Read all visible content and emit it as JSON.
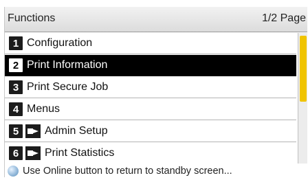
{
  "header": {
    "title": "Functions",
    "page_indicator": "1/2 Page"
  },
  "menu": {
    "items": [
      {
        "number": "1",
        "label": "Configuration",
        "icon": "",
        "selected": false
      },
      {
        "number": "2",
        "label": "Print Information",
        "icon": "",
        "selected": true
      },
      {
        "number": "3",
        "label": "Print Secure Job",
        "icon": "",
        "selected": false
      },
      {
        "number": "4",
        "label": "Menus",
        "icon": "",
        "selected": false
      },
      {
        "number": "5",
        "label": "Admin Setup",
        "icon": "key-lock-icon",
        "selected": false
      },
      {
        "number": "6",
        "label": "Print Statistics",
        "icon": "key-lock-icon",
        "selected": false
      }
    ]
  },
  "scrollbar": {
    "position_fraction": 0.5,
    "thumb_color": "#f0c400"
  },
  "status": {
    "icon": "info-icon",
    "message": "Use Online button to return to standby screen..."
  },
  "colors": {
    "selected_background": "#000000",
    "selected_text": "#ffffff"
  }
}
